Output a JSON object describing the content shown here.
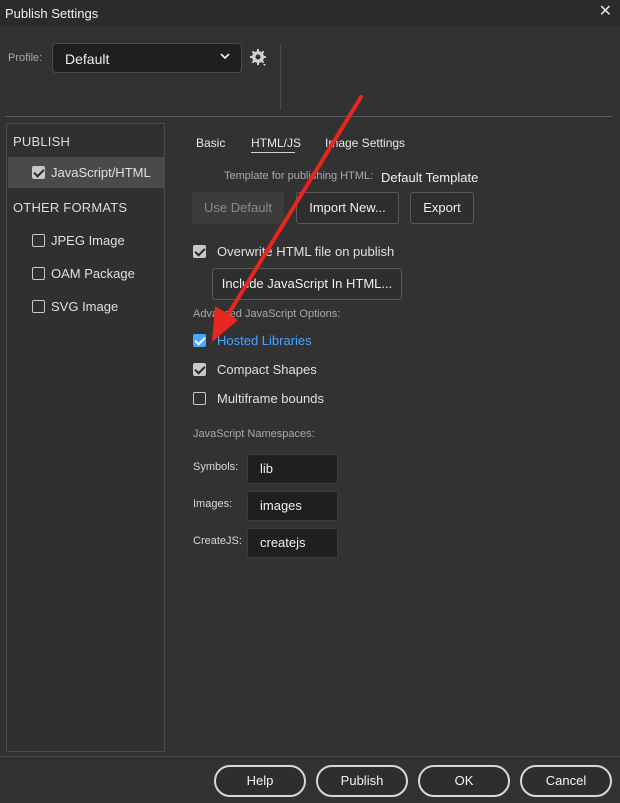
{
  "window": {
    "title": "Publish Settings",
    "close_glyph": "✕"
  },
  "profile": {
    "label": "Profile:",
    "value": "Default",
    "chevron": "⌄",
    "settings_icon": "gear-icon"
  },
  "sidebar": {
    "publish_heading": "PUBLISH",
    "publish_items": [
      {
        "label": "JavaScript/HTML",
        "checked": true,
        "selected": true
      }
    ],
    "other_heading": "OTHER FORMATS",
    "other_items": [
      {
        "label": "JPEG Image",
        "checked": false
      },
      {
        "label": "OAM Package",
        "checked": false
      },
      {
        "label": "SVG Image",
        "checked": false
      }
    ]
  },
  "tabs": [
    {
      "label": "Basic"
    },
    {
      "label": "HTML/JS",
      "active": true
    },
    {
      "label": "Image Settings"
    }
  ],
  "template": {
    "label": "Template for publishing HTML:",
    "value": "Default Template",
    "use_default": "Use Default",
    "import_new": "Import New...",
    "export": "Export"
  },
  "overwrite": {
    "label": "Overwrite HTML file on publish",
    "checked": true
  },
  "include_js_button": "Include JavaScript In HTML...",
  "advanced": {
    "heading": "Advanced JavaScript Options:",
    "hosted_libraries": {
      "label": "Hosted Libraries",
      "checked": true,
      "color": "#4aa3ff"
    },
    "compact_shapes": {
      "label": "Compact Shapes",
      "checked": true
    },
    "multiframe_bounds": {
      "label": "Multiframe bounds",
      "checked": false
    }
  },
  "namespaces": {
    "heading": "JavaScript Namespaces:",
    "symbols": {
      "label": "Symbols:",
      "value": "lib"
    },
    "images": {
      "label": "Images:",
      "value": "images"
    },
    "createjs": {
      "label": "CreateJS:",
      "value": "createjs"
    }
  },
  "footer": {
    "help": "Help",
    "publish": "Publish",
    "ok": "OK",
    "cancel": "Cancel"
  },
  "annotation": {
    "arrow_color": "#e8251f"
  }
}
